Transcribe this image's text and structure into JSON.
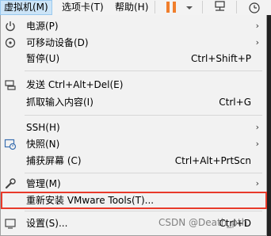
{
  "menubar": {
    "items": [
      {
        "label": "虚拟机(M)",
        "active": true
      },
      {
        "label": "选项卡(T)",
        "active": false
      },
      {
        "label": "帮助(H)",
        "active": false
      }
    ]
  },
  "vm_menu": {
    "items": [
      {
        "label": "电源(P)",
        "shortcut": "",
        "submenu": true,
        "icon": "power-icon"
      },
      {
        "label": "可移动设备(D)",
        "shortcut": "",
        "submenu": true,
        "icon": "removable-devices-icon"
      },
      {
        "label": "暂停(U)",
        "shortcut": "Ctrl+Shift+P",
        "submenu": false,
        "icon": ""
      },
      {
        "label": "发送 Ctrl+Alt+Del(E)",
        "shortcut": "",
        "submenu": false,
        "icon": "send-keys-icon"
      },
      {
        "label": "抓取输入内容(I)",
        "shortcut": "Ctrl+G",
        "submenu": false,
        "icon": ""
      },
      {
        "label": "SSH(H)",
        "shortcut": "",
        "submenu": true,
        "icon": ""
      },
      {
        "label": "快照(N)",
        "shortcut": "",
        "submenu": true,
        "icon": "snapshot-icon"
      },
      {
        "label": "捕获屏幕 (C)",
        "shortcut": "Ctrl+Alt+PrtScn",
        "submenu": false,
        "icon": ""
      },
      {
        "label": "管理(M)",
        "shortcut": "",
        "submenu": true,
        "icon": "wrench-icon"
      },
      {
        "label": "重新安装 VMware Tools(T)...",
        "shortcut": "",
        "submenu": false,
        "icon": ""
      },
      {
        "label": "设置(S)...",
        "shortcut": "Ctrl+D",
        "submenu": false,
        "icon": "settings-icon"
      }
    ]
  },
  "watermark": "CSDN @Death_pth",
  "colors": {
    "highlight": "#e83a2a",
    "pause": "#f07e2c",
    "menubar_active": "#cce4f7"
  }
}
